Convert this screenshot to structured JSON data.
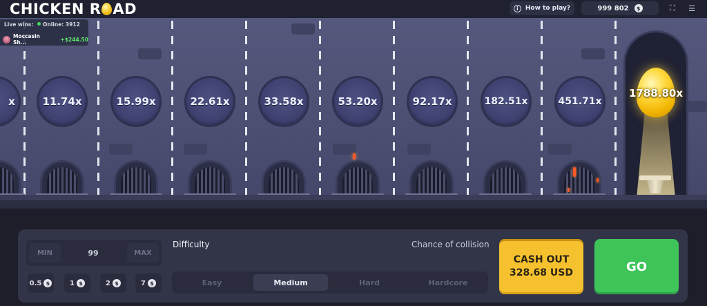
{
  "header": {
    "logo_left": "CHICKEN R",
    "logo_right": "AD",
    "how_to_play": "How to play?",
    "balance": "999 802",
    "currency_symbol": "$",
    "expand_icon": "⛶",
    "menu_icon": "☰"
  },
  "live_wins": {
    "label": "Live wins:",
    "online_label": "Online:",
    "online_count": "3912",
    "entries": [
      {
        "name": "Moccasin Sh...",
        "amount": "+$244.50"
      }
    ]
  },
  "lanes": {
    "partial_left_multiplier": "x",
    "multipliers": [
      "11.74x",
      "15.99x",
      "22.61x",
      "33.58x",
      "53.20x",
      "92.17x",
      "182.51x",
      "451.71x"
    ],
    "golden_multiplier": "1788.80x"
  },
  "controls": {
    "min_label": "MIN",
    "max_label": "MAX",
    "bet_value": "99",
    "chips": [
      "0.5",
      "1",
      "2",
      "7"
    ],
    "coin_symbol": "$",
    "difficulty_label": "Difficulty",
    "chance_label": "Chance of collision",
    "difficulties": [
      "Easy",
      "Medium",
      "Hard",
      "Hardcore"
    ],
    "active_difficulty": "Medium",
    "cashout_label": "CASH OUT",
    "cashout_amount": "328.68 USD",
    "go_label": "GO"
  }
}
